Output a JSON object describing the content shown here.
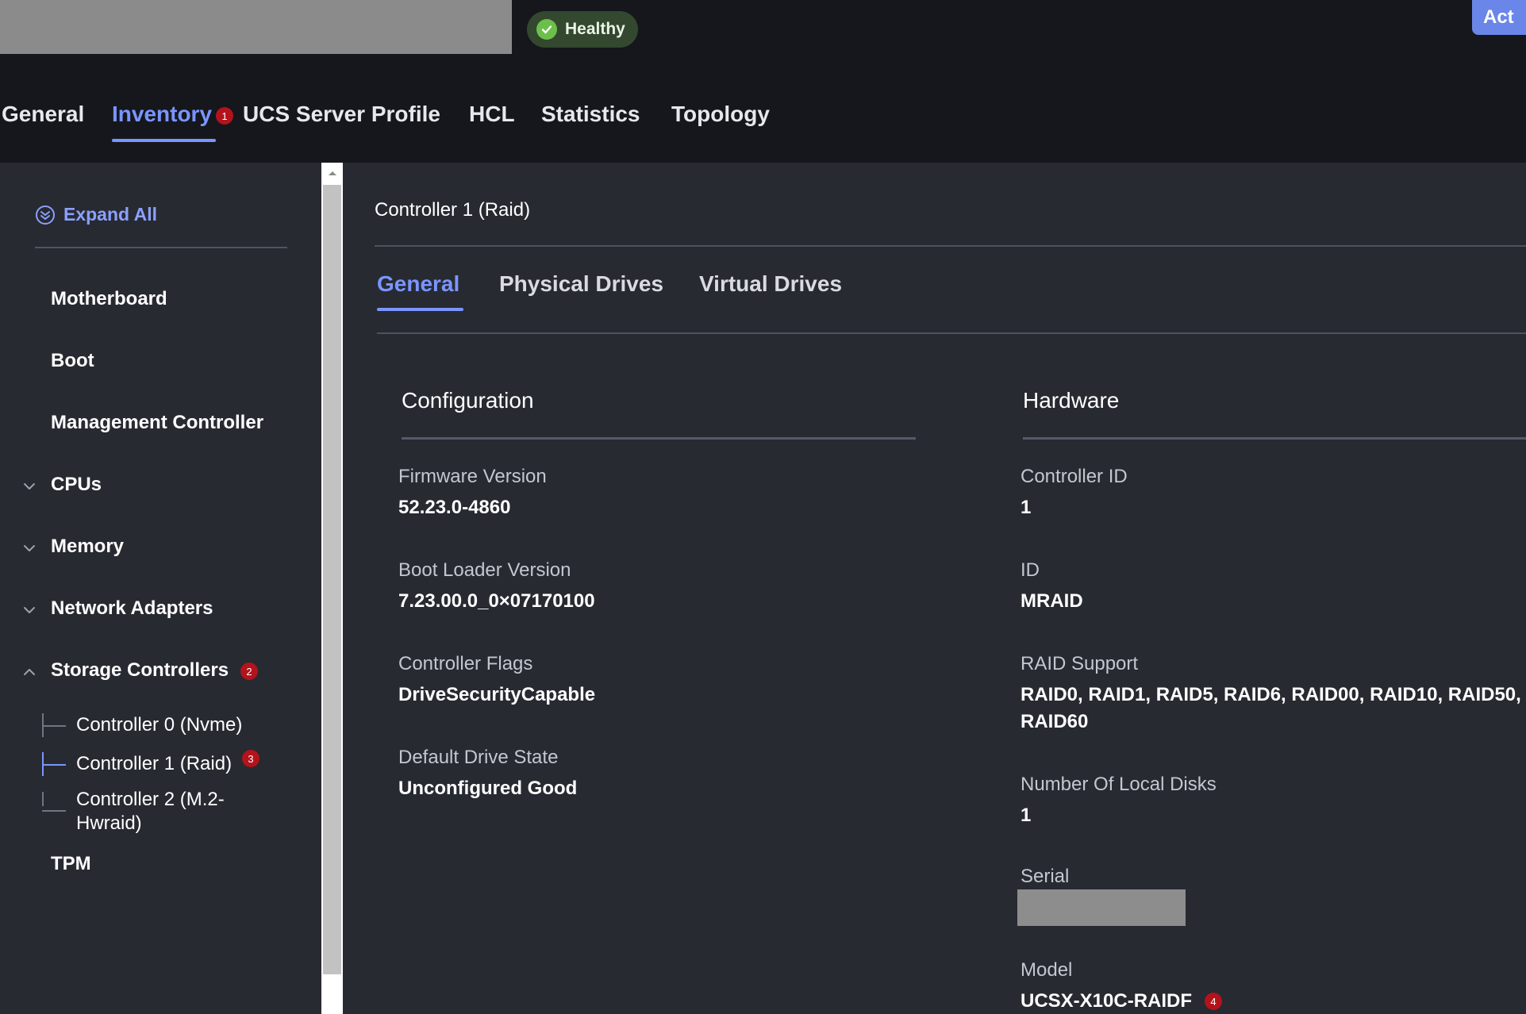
{
  "header": {
    "health_status": "Healthy",
    "actions_label": "Act"
  },
  "main_tabs": {
    "items": [
      {
        "label": "General"
      },
      {
        "label": "Inventory",
        "badge": "1"
      },
      {
        "label": "UCS Server Profile"
      },
      {
        "label": "HCL"
      },
      {
        "label": "Statistics"
      },
      {
        "label": "Topology"
      }
    ],
    "active": "Inventory"
  },
  "sidebar": {
    "expand_all_label": "Expand All",
    "items": [
      {
        "label": "Motherboard"
      },
      {
        "label": "Boot"
      },
      {
        "label": "Management Controller"
      },
      {
        "label": "CPUs"
      },
      {
        "label": "Memory"
      },
      {
        "label": "Network Adapters"
      },
      {
        "label": "Storage Controllers",
        "badge": "2"
      },
      {
        "label": "TPM"
      }
    ],
    "storage_children": [
      {
        "label": "Controller 0 (Nvme)"
      },
      {
        "label": "Controller 1 (Raid)",
        "badge": "3"
      },
      {
        "label": "Controller 2 (M.2-Hwraid)"
      }
    ]
  },
  "content": {
    "title": "Controller 1 (Raid)",
    "tabs": [
      {
        "label": "General"
      },
      {
        "label": "Physical Drives"
      },
      {
        "label": "Virtual Drives"
      }
    ],
    "active_tab": "General",
    "configuration": {
      "title": "Configuration",
      "fields": [
        {
          "label": "Firmware Version",
          "value": "52.23.0-4860"
        },
        {
          "label": "Boot Loader Version",
          "value": "7.23.00.0_0×07170100"
        },
        {
          "label": "Controller Flags",
          "value": "DriveSecurityCapable"
        },
        {
          "label": "Default Drive State",
          "value": "Unconfigured Good"
        }
      ]
    },
    "hardware": {
      "title": "Hardware",
      "fields": [
        {
          "label": "Controller ID",
          "value": "1"
        },
        {
          "label": "ID",
          "value": "MRAID"
        },
        {
          "label": "RAID Support",
          "value": "RAID0, RAID1, RAID5, RAID6, RAID00, RAID10, RAID50, RAID60"
        },
        {
          "label": "Number Of Local Disks",
          "value": "1"
        },
        {
          "label": "Serial",
          "value": ""
        },
        {
          "label": "Model",
          "value": "UCSX-X10C-RAIDF",
          "badge": "4"
        }
      ]
    }
  },
  "colors": {
    "accent": "#7b95ff",
    "badge": "#b3131b",
    "healthy": "#6cc04a",
    "panel": "#272a31",
    "header": "#15171c"
  }
}
